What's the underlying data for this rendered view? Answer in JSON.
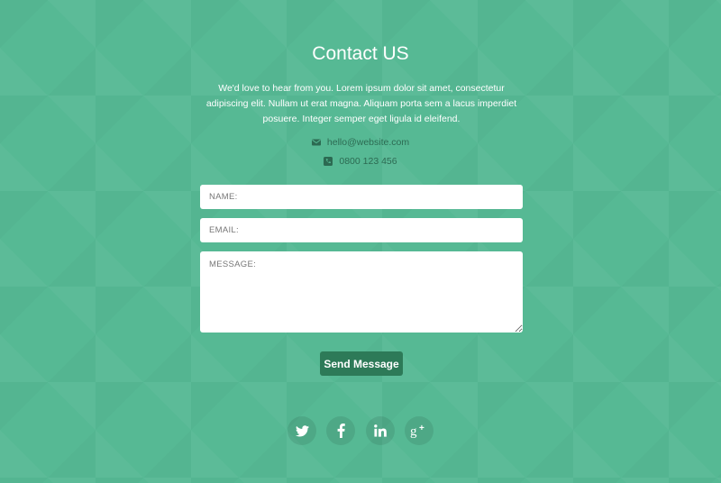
{
  "heading": "Contact US",
  "intro": "We'd love to hear from you. Lorem ipsum dolor sit amet, consectetur adipiscing elit. Nullam ut erat magna. Aliquam porta sem a lacus imperdiet posuere. Integer semper eget ligula id eleifend.",
  "contact": {
    "email": "hello@website.com",
    "email_icon": "envelope-icon",
    "phone": "0800 123 456",
    "phone_icon": "phone-icon"
  },
  "form": {
    "name_placeholder": "NAME:",
    "email_placeholder": "EMAIL:",
    "message_placeholder": "MESSAGE:",
    "submit_label": "Send Message"
  },
  "social": [
    {
      "icon": "twitter-icon"
    },
    {
      "icon": "facebook-icon"
    },
    {
      "icon": "linkedin-icon"
    },
    {
      "icon": "google-plus-icon"
    }
  ],
  "colors": {
    "background": "#56b994",
    "button": "#2d7a58",
    "contact_text": "#2c6a52"
  }
}
